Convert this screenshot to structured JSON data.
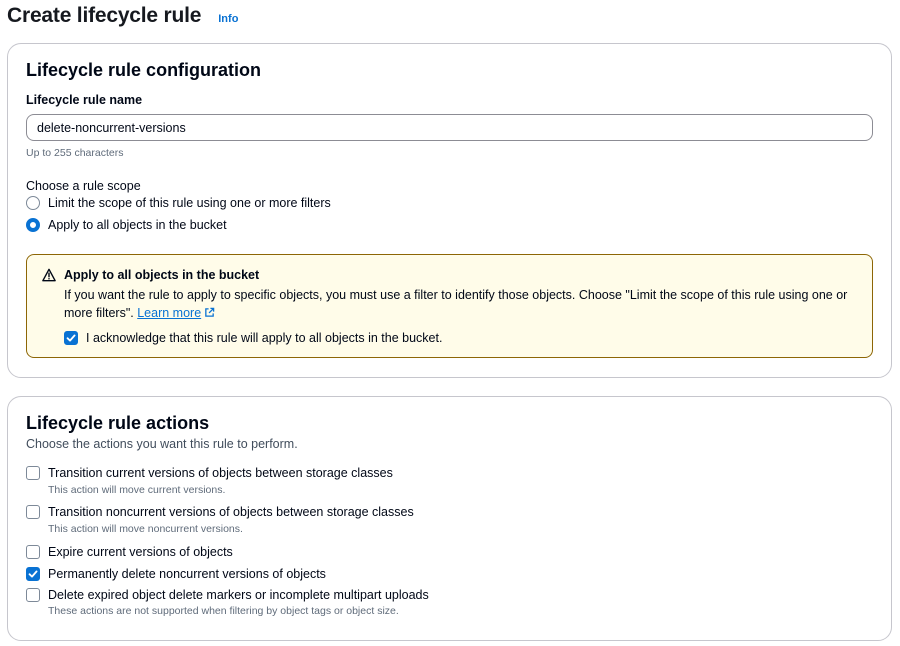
{
  "header": {
    "title": "Create lifecycle rule",
    "info": "Info"
  },
  "config": {
    "heading": "Lifecycle rule configuration",
    "name_label": "Lifecycle rule name",
    "name_value": "delete-noncurrent-versions",
    "name_constraint": "Up to 255 characters",
    "scope_label": "Choose a rule scope",
    "scope_options": [
      {
        "label": "Limit the scope of this rule using one or more filters",
        "checked": false
      },
      {
        "label": "Apply to all objects in the bucket",
        "checked": true
      }
    ],
    "alert": {
      "title": "Apply to all objects in the bucket",
      "body": "If you want the rule to apply to specific objects, you must use a filter to identify those objects. Choose \"Limit the scope of this rule using one or more filters\".",
      "link": "Learn more",
      "ack_label": "I acknowledge that this rule will apply to all objects in the bucket.",
      "ack_checked": true
    }
  },
  "actions": {
    "heading": "Lifecycle rule actions",
    "description": "Choose the actions you want this rule to perform.",
    "items": [
      {
        "label": "Transition current versions of objects between storage classes",
        "description": "This action will move current versions.",
        "checked": false
      },
      {
        "label": "Transition noncurrent versions of objects between storage classes",
        "description": "This action will move noncurrent versions.",
        "checked": false
      },
      {
        "label": "Expire current versions of objects",
        "description": "",
        "checked": false
      },
      {
        "label": "Permanently delete noncurrent versions of objects",
        "description": "",
        "checked": true
      },
      {
        "label": "Delete expired object delete markers or incomplete multipart uploads",
        "description": "These actions are not supported when filtering by object tags or object size.",
        "checked": false
      }
    ]
  },
  "colors": {
    "accent": "#0972d3",
    "warning_bg": "#fffce9",
    "warning_border": "#8d6605"
  }
}
